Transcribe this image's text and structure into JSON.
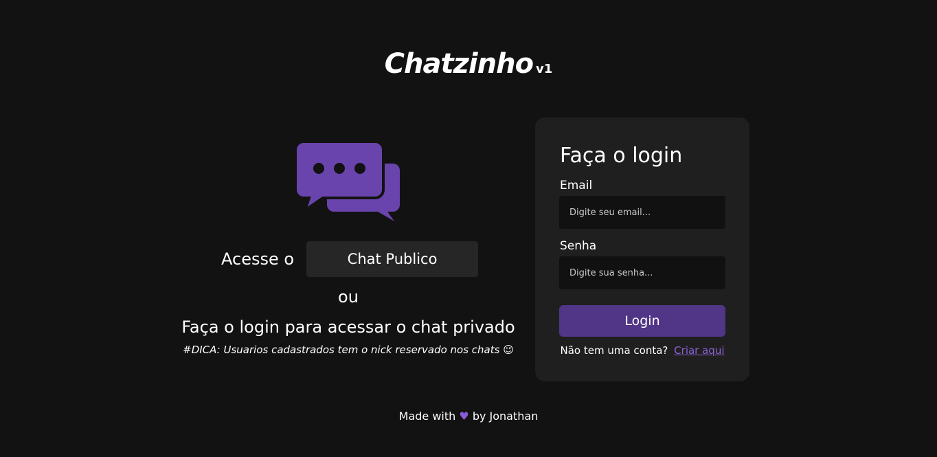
{
  "header": {
    "logo_name": "Chatzinho",
    "logo_version": "v1"
  },
  "left": {
    "icon": "chat-bubbles-icon",
    "access_label": "Acesse o",
    "public_chat_button": "Chat Publico",
    "or_text": "ou",
    "login_hint": "Faça o login para acessar o chat privado",
    "tip": "#DICA: Usuarios cadastrados tem o nick reservado nos chats 😉"
  },
  "login_card": {
    "title": "Faça o login",
    "email_label": "Email",
    "email_placeholder": "Digite seu email...",
    "password_label": "Senha",
    "password_placeholder": "Digite sua senha...",
    "login_button": "Login",
    "no_account_text": "Não tem uma conta?",
    "signup_link": "Criar aqui"
  },
  "footer": {
    "made_with": "Made with",
    "heart": "♥",
    "by": "by Jonathan"
  },
  "colors": {
    "background": "#121212",
    "card": "#1f1f1f",
    "accent": "#513586",
    "icon": "#6a44ad",
    "link": "#8e63d6"
  }
}
